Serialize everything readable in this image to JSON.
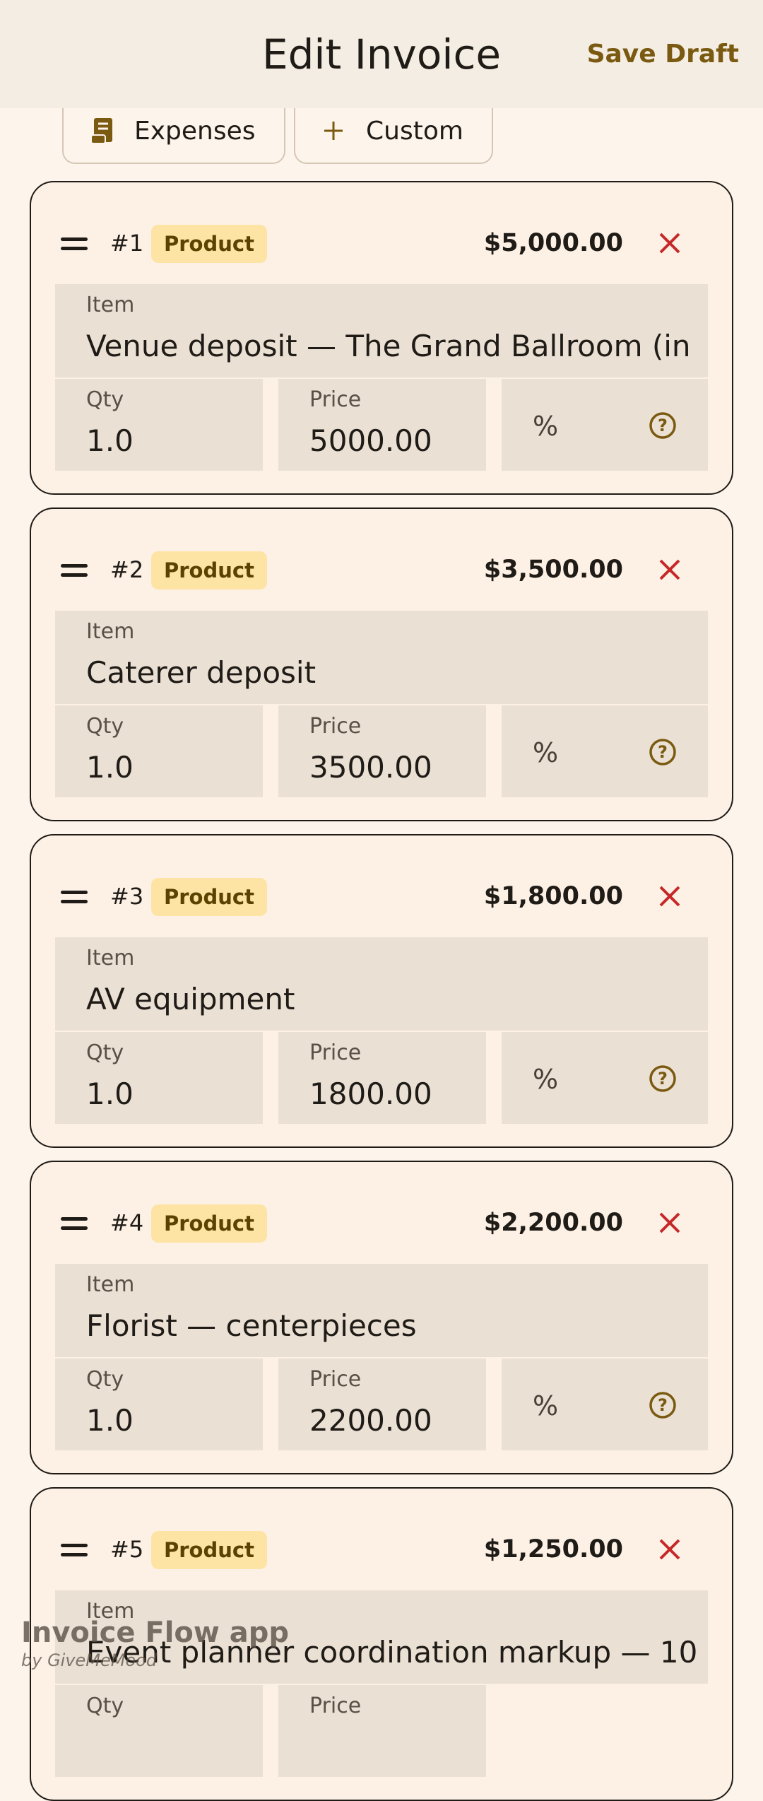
{
  "app_bar": {
    "title": "Edit Invoice",
    "save_label": "Save Draft"
  },
  "chips": [
    {
      "label": "Expenses",
      "icon": "receipt-icon"
    },
    {
      "label": "Custom",
      "icon": "plus-icon"
    }
  ],
  "field_labels": {
    "item": "Item",
    "qty": "Qty",
    "price": "Price",
    "pct": "%"
  },
  "items": [
    {
      "num": "#1",
      "badge": "Product",
      "amount": "$5,000.00",
      "name": "Venue deposit — The Grand Ballroom (in",
      "qty": "1.0",
      "price": "5000.00"
    },
    {
      "num": "#2",
      "badge": "Product",
      "amount": "$3,500.00",
      "name": "Caterer deposit",
      "qty": "1.0",
      "price": "3500.00"
    },
    {
      "num": "#3",
      "badge": "Product",
      "amount": "$1,800.00",
      "name": "AV equipment",
      "qty": "1.0",
      "price": "1800.00"
    },
    {
      "num": "#4",
      "badge": "Product",
      "amount": "$2,200.00",
      "name": "Florist — centerpieces",
      "qty": "1.0",
      "price": "2200.00"
    },
    {
      "num": "#5",
      "badge": "Product",
      "amount": "$1,250.00",
      "name": "Event planner coordination markup — 10",
      "qty": "",
      "price": ""
    }
  ],
  "watermark": {
    "title": "Invoice Flow app",
    "subtitle": "by GiveMeMood"
  },
  "colors": {
    "accent": "#7a5a10",
    "remove": "#c62828",
    "badge_bg": "#fde3a4",
    "card_bg": "#fdf1e6",
    "field_bg": "#ebe0d4"
  }
}
